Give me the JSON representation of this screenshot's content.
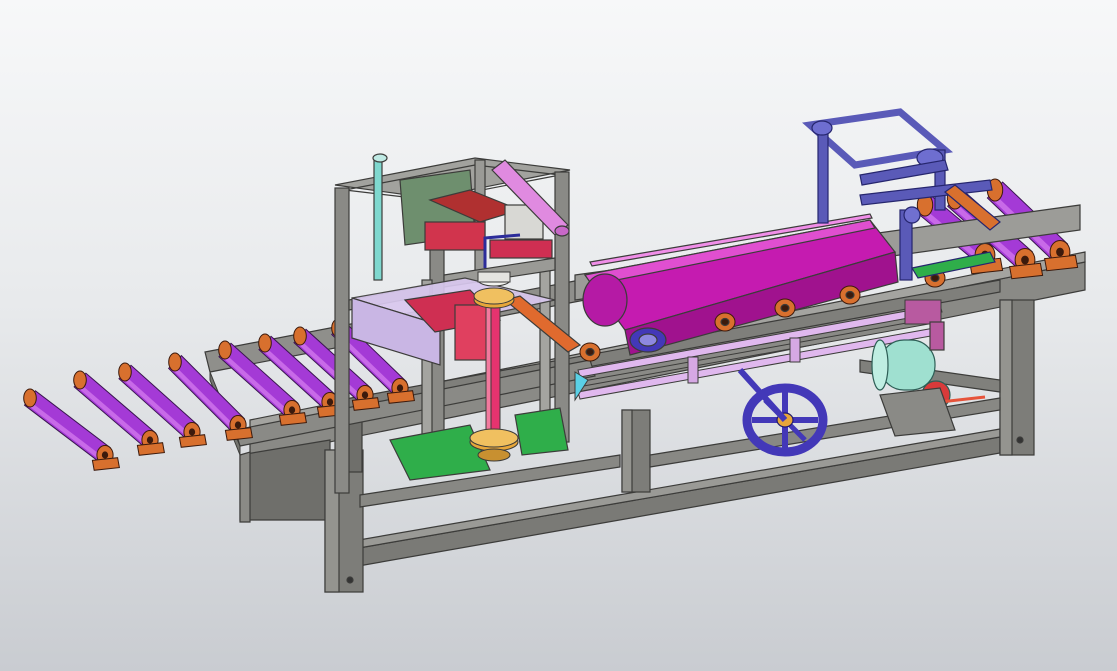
{
  "viewport": {
    "background_top": "#f7f8f9",
    "background_bottom": "#c9ccd1"
  },
  "model": {
    "colors": {
      "frame": "#8a8a86",
      "frame_dark": "#6c6c68",
      "frame_edge": "#3c3c3a",
      "roller": "#a43ad6",
      "roller_light": "#c86ae8",
      "roller_end": "#d8702e",
      "belt": "#c51bb0",
      "belt_light": "#e04fd0",
      "guard_panel": "#d9c8ef",
      "drive_column": "#e6336f",
      "gear": "#e7a63a",
      "blue_frame": "#5a5ab8",
      "handwheel": "#4338b8",
      "motor": "#9fe0d0",
      "motor_flange": "#d83a3a",
      "green_bracket": "#2fae4a",
      "rail": "#d6a8e4",
      "red_rod": "#e6533a"
    },
    "components": [
      "outfeed-roller-table",
      "infeed-roller-table",
      "cutting-gantry",
      "drive-column",
      "belt-conveyor",
      "tensioner-frame",
      "handwheel",
      "drive-motor",
      "guide-rails",
      "base-frame"
    ]
  }
}
